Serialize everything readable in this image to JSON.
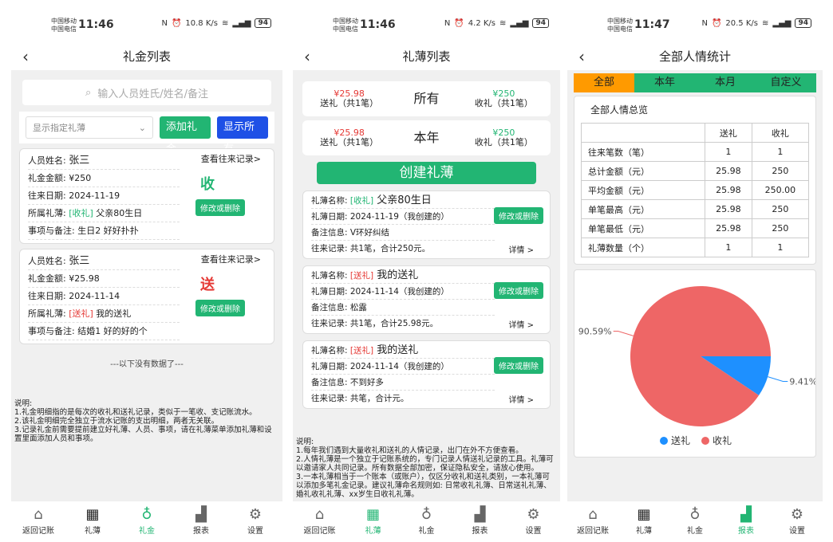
{
  "status": [
    {
      "carrier1": "中国移动",
      "carrier2": "中国电信",
      "time": "11:46",
      "speed": "10.8 K/s",
      "battery": "94"
    },
    {
      "carrier1": "中国移动",
      "carrier2": "中国电信",
      "time": "11:46",
      "speed": "4.2 K/s",
      "battery": "94"
    },
    {
      "carrier1": "中国移动",
      "carrier2": "中国电信",
      "time": "11:47",
      "speed": "20.5 K/s",
      "battery": "94"
    }
  ],
  "s1": {
    "title": "礼金列表",
    "search_placeholder": "输入人员姓氏/姓名/备注",
    "select": "显示指定礼薄",
    "add": "添加礼金",
    "show_all": "显示所有",
    "records": [
      {
        "name_l": "人员姓名: ",
        "name": "张三",
        "amount": "礼金金额: ¥250",
        "date": "往来日期: 2024-11-19",
        "book_l": "所属礼薄: ",
        "book_tag": "[收礼]",
        "book": " 父亲80生日",
        "note": "事项与备注: 生日2 好好扑扑",
        "kind": "收",
        "link": "查看往来记录>",
        "mod": "修改或删除"
      },
      {
        "name_l": "人员姓名: ",
        "name": "张三",
        "amount": "礼金金额: ¥25.98",
        "date": "往来日期: 2024-11-14",
        "book_l": "所属礼薄: ",
        "book_tag": "[送礼]",
        "book": " 我的送礼",
        "note": "事项与备注: 结婚1 好的好的个",
        "kind": "送",
        "link": "查看往来记录>",
        "mod": "修改或删除"
      }
    ],
    "nomore": "---以下没有数据了---",
    "note": [
      "说明:",
      "1.礼金明细指的是每次的收礼和送礼记录，类似于一笔收、支记账流水。",
      "2.该礼金明细完全独立于流水记账的支出明细，两者无关联。",
      "3.记录礼金前需要提前建立好礼薄、人员、事项，请在礼薄菜单添加礼薄和设置里面添加人员和事项。"
    ]
  },
  "s2": {
    "title": "礼薄列表",
    "sums": [
      {
        "out_amt": "¥25.98",
        "out_l": "送礼（共1笔）",
        "mid": "所有",
        "in_amt": "¥250",
        "in_l": "收礼（共1笔）"
      },
      {
        "out_amt": "¥25.98",
        "out_l": "送礼（共1笔）",
        "mid": "本年",
        "in_amt": "¥250",
        "in_l": "收礼（共1笔）"
      }
    ],
    "create": "创建礼薄",
    "books": [
      {
        "name_l": "礼薄名称: ",
        "tag": "[收礼]",
        "name": " 父亲80生日",
        "date": "礼薄日期: 2024-11-19（我创建的）",
        "note": "备注信息: V环好纠结",
        "rec": "往来记录: 共1笔，合计250元。",
        "detail": "详情 >",
        "mod": "修改或删除"
      },
      {
        "name_l": "礼薄名称: ",
        "tag": "[送礼]",
        "name": " 我的送礼",
        "date": "礼薄日期: 2024-11-14（我创建的）",
        "note": "备注信息: 松露",
        "rec": "往来记录: 共1笔，合计25.98元。",
        "detail": "详情 >",
        "mod": "修改或删除"
      },
      {
        "name_l": "礼薄名称: ",
        "tag": "[送礼]",
        "name": " 我的送礼",
        "date": "礼薄日期: 2024-11-14（我创建的）",
        "note": "备注信息: 不到好多",
        "rec": "往来记录: 共笔，合计元。",
        "detail": "详情 >",
        "mod": "修改或删除"
      }
    ],
    "note": [
      "说明:",
      "1.每年我们遇到大量收礼和送礼的人情记录，出门在外不方便查看。",
      "2.人情礼薄是一个独立于记账系统的，专门记录人情送礼记录的工具。礼薄可以邀请家人共同记录。所有数据全部加密，保证隐私安全，请放心使用。",
      "3.一本礼薄相当于一个账本（或账户），仅区分收礼和送礼类别，一本礼薄可以添加多笔礼金记录。建议礼薄命名规则如: 日常收礼礼簿、日常送礼礼薄、婚礼收礼礼薄、xx岁生日收礼礼薄。"
    ]
  },
  "s3": {
    "title": "全部人情统计",
    "segs": [
      "全部",
      "本年",
      "本月",
      "自定义"
    ],
    "overview": "全部人情总览",
    "table": {
      "head": [
        "",
        "送礼",
        "收礼"
      ],
      "rows": [
        [
          "往来笔数（笔）",
          "1",
          "1"
        ],
        [
          "总计金额（元）",
          "25.98",
          "250"
        ],
        [
          "平均金额（元）",
          "25.98",
          "250.00"
        ],
        [
          "单笔最高（元）",
          "25.98",
          "250"
        ],
        [
          "单笔最低（元）",
          "25.98",
          "250"
        ],
        [
          "礼薄数量（个）",
          "1",
          "1"
        ]
      ]
    }
  },
  "tabs": [
    [
      "返回记账",
      "礼薄",
      "礼金",
      "报表",
      "设置"
    ],
    [
      "返回记账",
      "礼薄",
      "礼金",
      "报表",
      "设置"
    ],
    [
      "返回记账",
      "礼薄",
      "礼金",
      "报表",
      "设置"
    ]
  ],
  "chart_data": {
    "type": "pie",
    "series": [
      {
        "name": "送礼",
        "value": 9.41,
        "color": "#1e90ff"
      },
      {
        "name": "收礼",
        "value": 90.59,
        "color": "#ee6666"
      }
    ],
    "labels": [
      "9.41%",
      "90.59%"
    ],
    "legend": [
      "送礼",
      "收礼"
    ]
  }
}
